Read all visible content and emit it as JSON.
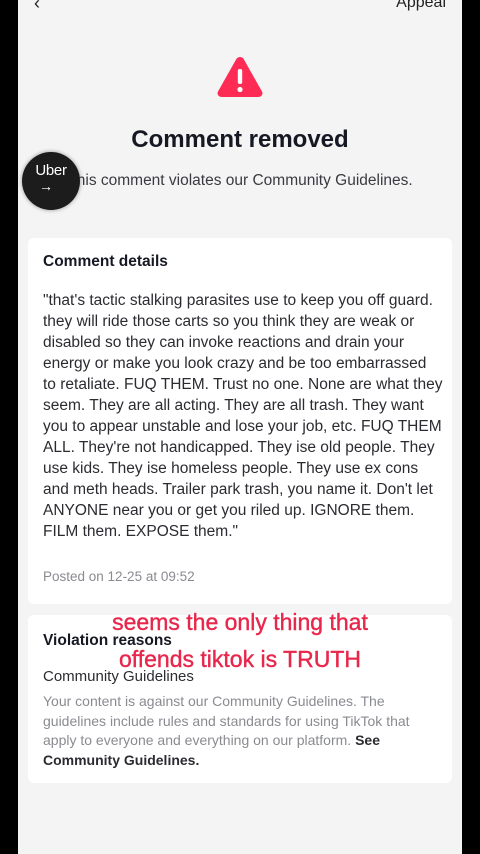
{
  "header": {
    "back_icon": "chevron-left-icon",
    "appeal_label": "Appeal"
  },
  "status": {
    "icon": "warning-triangle-icon",
    "icon_color": "#fe2c55",
    "title": "Comment removed",
    "subtitle": "This comment violates our Community Guidelines."
  },
  "overlay_badge": {
    "label": "Uber",
    "icon": "arrow-right-icon"
  },
  "details": {
    "heading": "Comment details",
    "comment": "\"that's tactic stalking parasites use to keep you off guard. they will ride those carts so you think they are weak or disabled so they can invoke reactions and drain your energy or make you look crazy and be too embarrassed to retaliate. FUQ THEM. Trust no one. None are what they seem. They are all acting. They are all trash. They want you to appear unstable and lose your job, etc. FUQ THEM ALL. They're not handicapped. They ise old people. They use kids. They ise homeless people. They use ex cons and meth heads. Trailer park trash, you name it. Don't let ANYONE near you or get you riled up. IGNORE them. FILM them. EXPOSE them.\"",
    "posted": "Posted on 12-25 at 09:52"
  },
  "violation": {
    "heading": "Violation reasons",
    "category": "Community Guidelines",
    "description": "Your content is against our Community Guidelines. The guidelines include rules and standards for using TikTok that apply to everyone and everything on our platform.",
    "link": "See Community Guidelines."
  },
  "caption": {
    "line1": "seems the only thing that",
    "line2": "offends tiktok is TRUTH",
    "color": "#e8274c"
  }
}
